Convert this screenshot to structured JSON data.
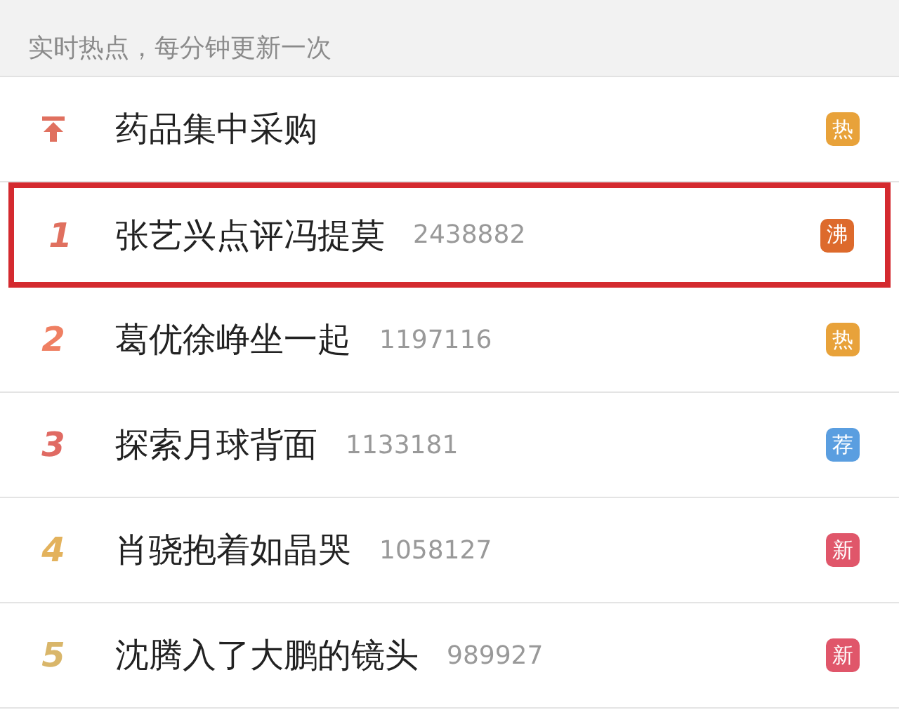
{
  "header": {
    "text": "实时热点，每分钟更新一次"
  },
  "items": [
    {
      "kind": "pinned",
      "title": "药品集中采购",
      "badge": {
        "text": "热",
        "color": "#e8a23a"
      },
      "selected": false
    },
    {
      "kind": "ranked",
      "rank": "1",
      "color": "#e0705f",
      "title": "张艺兴点评冯提莫",
      "count": "2438882",
      "badge": {
        "text": "沸",
        "color": "#dd6a2c"
      },
      "selected": true
    },
    {
      "kind": "ranked",
      "rank": "2",
      "color": "#ef7f62",
      "title": "葛优徐峥坐一起",
      "count": "1197116",
      "badge": {
        "text": "热",
        "color": "#e8a23a"
      },
      "selected": false
    },
    {
      "kind": "ranked",
      "rank": "3",
      "color": "#e06a63",
      "title": "探索月球背面",
      "count": "1133181",
      "badge": {
        "text": "荐",
        "color": "#5a9ee0"
      },
      "selected": false
    },
    {
      "kind": "ranked",
      "rank": "4",
      "color": "#e3b25c",
      "title": "肖骁抱着如晶哭",
      "count": "1058127",
      "badge": {
        "text": "新",
        "color": "#e0566a"
      },
      "selected": false
    },
    {
      "kind": "ranked",
      "rank": "5",
      "color": "#d9b66a",
      "title": "沈腾入了大鹏的镜头",
      "count": "989927",
      "badge": {
        "text": "新",
        "color": "#e0566a"
      },
      "selected": false
    }
  ]
}
